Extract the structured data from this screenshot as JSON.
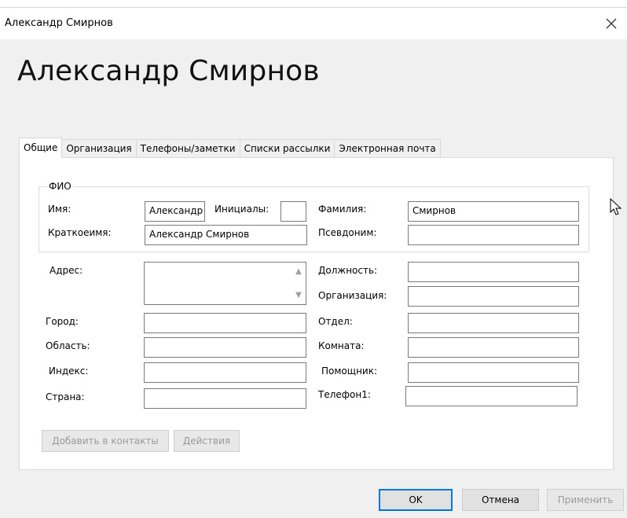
{
  "window": {
    "title": "Александр Смирнов",
    "heading": "Александр Смирнов",
    "close_icon": "close-icon"
  },
  "tabs": [
    {
      "label": "Общие",
      "active": true
    },
    {
      "label": "Организация"
    },
    {
      "label": "Телефоны/заметки"
    },
    {
      "label": "Списки рассылки"
    },
    {
      "label": "Электронная почта"
    }
  ],
  "fio": {
    "group_label": "ФИО",
    "first_name_label": "Имя:",
    "first_name_value": "Александр",
    "initials_label": "Инициалы:",
    "initials_value": "",
    "last_name_label": "Фамилия:",
    "last_name_value": "Смирнов",
    "display_name_label": "Краткоеимя:",
    "display_name_value": "Александр Смирнов",
    "nickname_label": "Псевдоним:",
    "nickname_value": ""
  },
  "left_fields": {
    "address_label": "Адрес:",
    "address_value": "",
    "city_label": "Город:",
    "city_value": "",
    "region_label": "Область:",
    "region_value": "",
    "zip_label": "Индекс:",
    "zip_value": "",
    "country_label": "Страна:",
    "country_value": ""
  },
  "right_fields": {
    "position_label": "Должность:",
    "position_value": "",
    "org_label": "Организация:",
    "org_value": "",
    "dept_label": "Отдел:",
    "dept_value": "",
    "room_label": "Комната:",
    "room_value": "",
    "assistant_label": "Помощник:",
    "assistant_value": "",
    "phone1_label": "Телефон1:",
    "phone1_value": ""
  },
  "actions": {
    "add_to_contacts": "Добавить в контакты",
    "actions": "Действия"
  },
  "footer": {
    "ok": "OK",
    "cancel": "Отмена",
    "apply": "Применить"
  },
  "colors": {
    "accent": "#0078d7",
    "background": "#f0f0f0"
  }
}
